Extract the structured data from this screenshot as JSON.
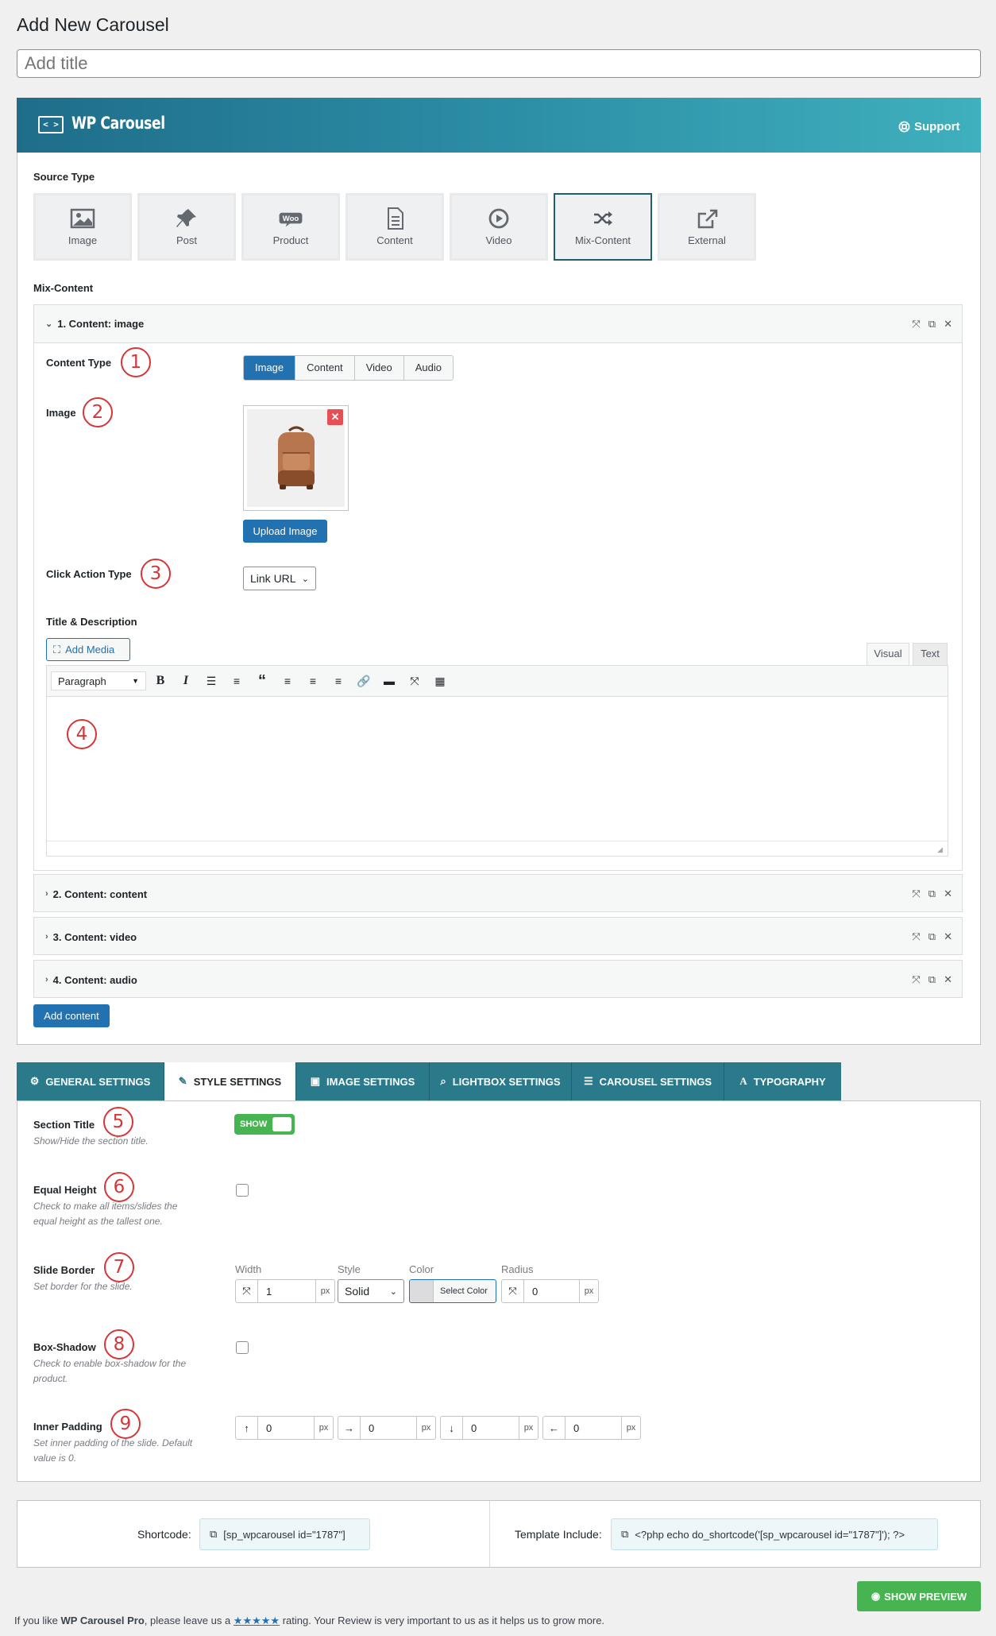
{
  "page": {
    "title": "Add New Carousel",
    "title_placeholder": "Add title"
  },
  "banner": {
    "logo_symbol": "< >",
    "logo_text": "WP Carousel",
    "support_label": "Support"
  },
  "source_type": {
    "label": "Source Type",
    "options": [
      "Image",
      "Post",
      "Product",
      "Content",
      "Video",
      "Mix-Content",
      "External"
    ],
    "woo_text": "Woo",
    "selected": "Mix-Content"
  },
  "mix_content": {
    "label": "Mix-Content",
    "items": [
      {
        "title": "1. Content: image",
        "expanded": true
      },
      {
        "title": "2. Content: content",
        "expanded": false
      },
      {
        "title": "3. Content: video",
        "expanded": false
      },
      {
        "title": "4. Content: audio",
        "expanded": false
      }
    ],
    "content_type": {
      "label": "Content Type",
      "options": [
        "Image",
        "Content",
        "Video",
        "Audio"
      ],
      "selected": "Image"
    },
    "image": {
      "label": "Image",
      "upload_label": "Upload Image"
    },
    "click_action": {
      "label": "Click Action Type",
      "value": "Link URL"
    },
    "title_desc": {
      "label": "Title & Description",
      "add_media": "Add Media",
      "tabs": [
        "Visual",
        "Text"
      ],
      "format_value": "Paragraph"
    },
    "add_content_label": "Add content"
  },
  "annotations": [
    "1",
    "2",
    "3",
    "4",
    "5",
    "6",
    "7",
    "8",
    "9"
  ],
  "settings_tabs": [
    {
      "label": "GENERAL SETTINGS",
      "icon": "gear-icon"
    },
    {
      "label": "STYLE SETTINGS",
      "icon": "brush-icon"
    },
    {
      "label": "IMAGE SETTINGS",
      "icon": "image-icon"
    },
    {
      "label": "LIGHTBOX SETTINGS",
      "icon": "search-icon"
    },
    {
      "label": "CAROUSEL SETTINGS",
      "icon": "sliders-icon"
    },
    {
      "label": "TYPOGRAPHY",
      "icon": "font-icon"
    }
  ],
  "style": {
    "section_title": {
      "label": "Section Title",
      "desc": "Show/Hide the section title.",
      "toggle": "SHOW"
    },
    "equal_height": {
      "label": "Equal Height",
      "desc1": "Check to make all items/slides the",
      "desc2": "equal height as the tallest one."
    },
    "slide_border": {
      "label": "Slide Border",
      "desc": "Set border for the slide.",
      "width_label": "Width",
      "width_value": "1",
      "width_unit": "px",
      "style_label": "Style",
      "style_value": "Solid",
      "color_label": "Color",
      "color_button": "Select Color",
      "radius_label": "Radius",
      "radius_value": "0",
      "radius_unit": "px"
    },
    "box_shadow": {
      "label": "Box-Shadow",
      "desc1": "Check to enable box-shadow for the",
      "desc2": "product."
    },
    "inner_padding": {
      "label": "Inner Padding",
      "desc1": "Set inner padding of the slide. Default",
      "desc2": "value is 0.",
      "values": [
        "0",
        "0",
        "0",
        "0"
      ],
      "unit": "px"
    }
  },
  "shortcode": {
    "label": "Shortcode:",
    "value": "[sp_wpcarousel id=\"1787\"]",
    "template_label": "Template Include:",
    "template_value": "<?php echo do_shortcode('[sp_wpcarousel id=\"1787\"]'); ?>"
  },
  "preview_button": "SHOW PREVIEW",
  "footer": {
    "prefix": "If you like ",
    "product": "WP Carousel Pro",
    "middle": ", please leave us a ",
    "stars": "★★★★★",
    "suffix": " rating. Your Review is very important to us as it helps us to grow more."
  },
  "colors": {
    "accent": "#2271b1",
    "banner_start": "#1f6d8a",
    "banner_end": "#3fb0bd",
    "toggle": "#46b450",
    "annotation": "#d63638",
    "tab_bg": "#2a7a8c"
  }
}
